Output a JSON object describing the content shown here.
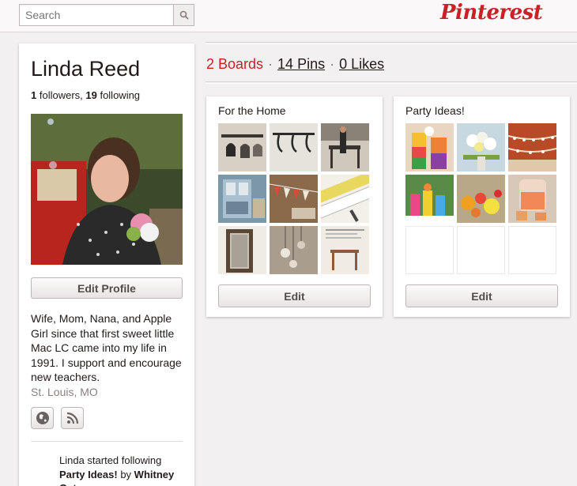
{
  "header": {
    "search_placeholder": "Search",
    "logo_text": "Pinterest"
  },
  "profile": {
    "name": "Linda Reed",
    "followers_count": "1",
    "followers_label": " followers, ",
    "following_count": "19",
    "following_label": " following",
    "edit_profile_label": "Edit Profile",
    "bio": "Wife, Mom, Nana, and Apple Girl since that first sweet little Mac LC came into my life in 1991. I support and encourage new teachers.",
    "location": "St. Louis, MO",
    "social_icons": [
      "globe-icon",
      "rss-icon"
    ],
    "activity": {
      "text_before": "Linda started following ",
      "board_name": "Party Ideas!",
      "text_by": " by ",
      "owner": "Whitney Ostercamp"
    }
  },
  "tabs": {
    "boards": "2 Boards",
    "pins": "14 Pins",
    "likes": "0 Likes",
    "separator": "·"
  },
  "boards": [
    {
      "title": "For the Home",
      "edit_label": "Edit",
      "thumbs": [
        "hooks-with-bags",
        "wire-hooks",
        "chalkboard-easel",
        "blue-cabinet",
        "bunting-banner",
        "stencil-letters",
        "wood-frame-mirror",
        "hanging-ornaments",
        "side-table-article"
      ]
    },
    {
      "title": "Party Ideas!",
      "edit_label": "Edit",
      "thumbs": [
        "layered-drinks",
        "flower-arrangement",
        "paper-garland",
        "candy-buffet",
        "pom-pom-garland",
        "drink-dispenser",
        "",
        "",
        ""
      ]
    }
  ],
  "colors": {
    "accent": "#cb2027",
    "background": "#f2f0f0",
    "text": "#221919",
    "muted": "#8c7e7e"
  }
}
